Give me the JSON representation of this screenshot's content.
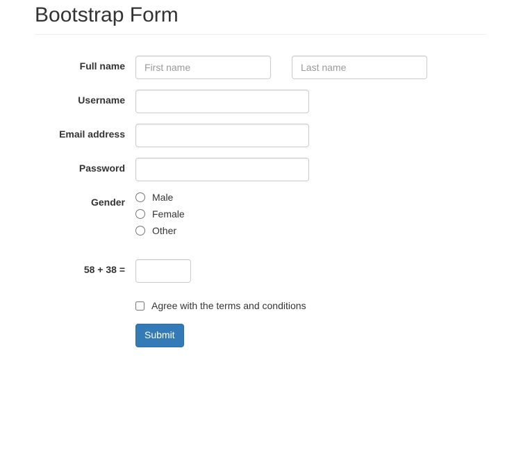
{
  "header": {
    "title": "Bootstrap Form"
  },
  "form": {
    "fullname": {
      "label": "Full name",
      "first_placeholder": "First name",
      "first_value": "",
      "last_placeholder": "Last name",
      "last_value": ""
    },
    "username": {
      "label": "Username",
      "value": ""
    },
    "email": {
      "label": "Email address",
      "value": ""
    },
    "password": {
      "label": "Password",
      "value": ""
    },
    "gender": {
      "label": "Gender",
      "options": {
        "male": "Male",
        "female": "Female",
        "other": "Other"
      },
      "selected": ""
    },
    "captcha": {
      "label": "58 + 38 =",
      "value": ""
    },
    "terms": {
      "label": "Agree with the terms and conditions",
      "checked": false
    },
    "submit": {
      "label": "Submit"
    }
  }
}
